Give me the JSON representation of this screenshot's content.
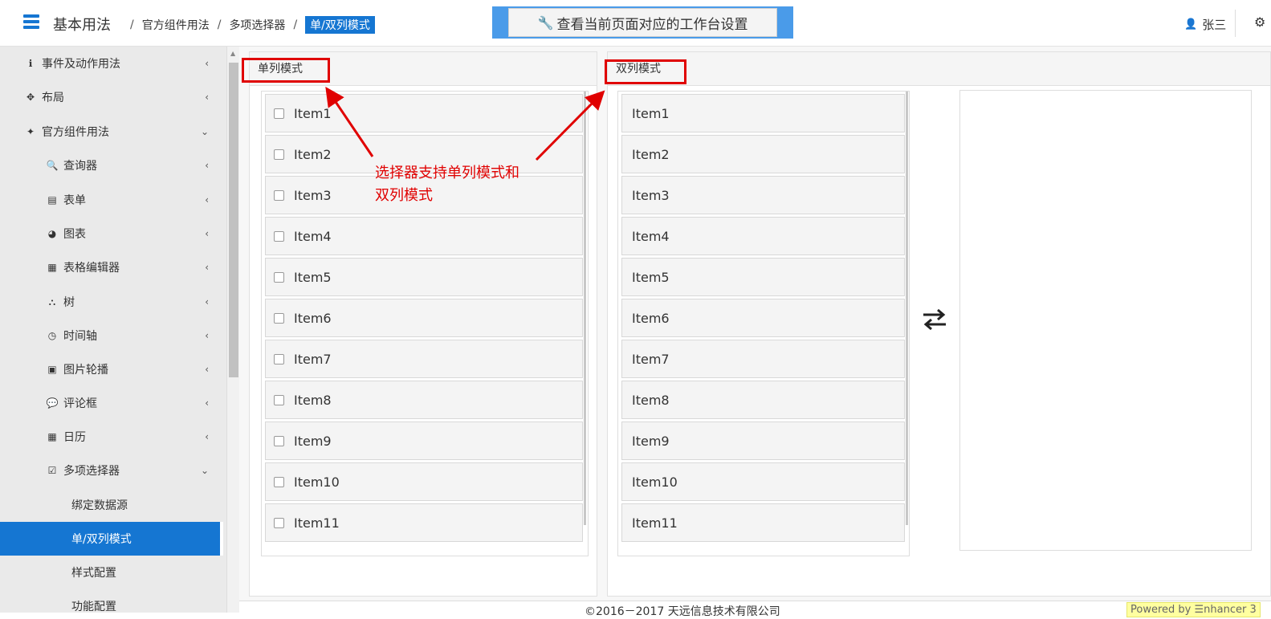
{
  "header": {
    "brand": "基本用法",
    "breadcrumb": [
      "官方组件用法",
      "多项选择器",
      "单/双列模式"
    ],
    "breadcrumb_sep": "/",
    "workbench_button": "查看当前页面对应的工作台设置",
    "user_name": "张三"
  },
  "sidebar": {
    "items": [
      {
        "label": "事件及动作用法",
        "icon": "info-circle-icon",
        "glyph": "ℹ",
        "chevron": "‹"
      },
      {
        "label": "布局",
        "icon": "arrows-move-icon",
        "glyph": "✥",
        "chevron": "‹"
      },
      {
        "label": "官方组件用法",
        "icon": "puzzle-icon",
        "glyph": "✦",
        "chevron": "⌄"
      },
      {
        "label": "查询器",
        "icon": "search-icon",
        "glyph": "🔍",
        "chevron": "‹"
      },
      {
        "label": "表单",
        "icon": "list-alt-icon",
        "glyph": "▤",
        "chevron": "‹"
      },
      {
        "label": "图表",
        "icon": "pie-chart-icon",
        "glyph": "◕",
        "chevron": "‹"
      },
      {
        "label": "表格编辑器",
        "icon": "table-icon",
        "glyph": "▦",
        "chevron": "‹"
      },
      {
        "label": "树",
        "icon": "sitemap-icon",
        "glyph": "⛬",
        "chevron": "‹"
      },
      {
        "label": "时间轴",
        "icon": "clock-icon",
        "glyph": "◷",
        "chevron": "‹"
      },
      {
        "label": "图片轮播",
        "icon": "image-icon",
        "glyph": "▣",
        "chevron": "‹"
      },
      {
        "label": "评论框",
        "icon": "comment-icon",
        "glyph": "💬",
        "chevron": "‹"
      },
      {
        "label": "日历",
        "icon": "calendar-icon",
        "glyph": "▦",
        "chevron": "‹"
      },
      {
        "label": "多项选择器",
        "icon": "check-square-icon",
        "glyph": "☑",
        "chevron": "⌄"
      },
      {
        "label": "绑定数据源",
        "icon": "",
        "glyph": "",
        "chevron": ""
      },
      {
        "label": "单/双列模式",
        "icon": "",
        "glyph": "",
        "chevron": ""
      },
      {
        "label": "样式配置",
        "icon": "",
        "glyph": "",
        "chevron": ""
      },
      {
        "label": "功能配置",
        "icon": "",
        "glyph": "",
        "chevron": ""
      }
    ]
  },
  "single_panel": {
    "title": "单列模式",
    "items": [
      "Item1",
      "Item2",
      "Item3",
      "Item4",
      "Item5",
      "Item6",
      "Item7",
      "Item8",
      "Item9",
      "Item10",
      "Item11"
    ]
  },
  "double_panel": {
    "title": "双列模式",
    "items": [
      "Item1",
      "Item2",
      "Item3",
      "Item4",
      "Item5",
      "Item6",
      "Item7",
      "Item8",
      "Item9",
      "Item10",
      "Item11"
    ]
  },
  "annotation": [
    "选择器支持单列模式和",
    "双列模式"
  ],
  "footer": {
    "copyright": "©2016－2017 天远信息技术有限公司",
    "powered": "Powered by ☰nhancer 3"
  },
  "colors": {
    "accent": "#1576d2",
    "annotation_red": "#e00000"
  }
}
